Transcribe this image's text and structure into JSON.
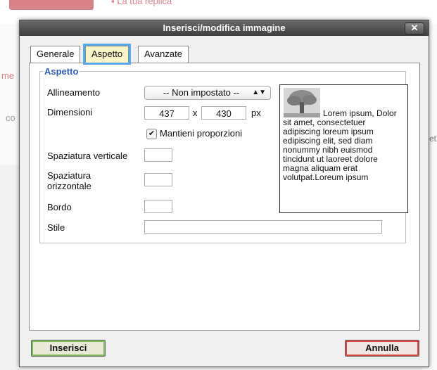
{
  "background": {
    "reply_text": "La tua replica",
    "left_fragment_1": "me",
    "left_fragment_2": "co",
    "right_fragment": "et"
  },
  "dialog": {
    "title": "Inserisci/modifica immagine",
    "close_label": "✕",
    "tabs": [
      {
        "label": "Generale",
        "active": false
      },
      {
        "label": "Aspetto",
        "active": true
      },
      {
        "label": "Avanzate",
        "active": false
      }
    ],
    "fieldset_legend": "Aspetto",
    "fields": {
      "alignment_label": "Allineamento",
      "alignment_value": "-- Non impostato --",
      "dimensions_label": "Dimensioni",
      "width_value": "437",
      "dimension_separator": "x",
      "height_value": "430",
      "unit": "px",
      "keep_proportions_label": "Mantieni proporzioni",
      "keep_proportions_checked": true,
      "vspace_label": "Spaziatura verticale",
      "vspace_value": "",
      "hspace_label_line1": "Spaziatura",
      "hspace_label_line2": "orizzontale",
      "hspace_value": "",
      "border_label": "Bordo",
      "border_value": "",
      "style_label": "Stile",
      "style_value": ""
    },
    "preview_text": "Lorem ipsum, Dolor sit amet, consectetuer adipiscing loreum ipsum edipiscing elit, sed diam nonummy nibh euismod tincidunt ut laoreet dolore magna aliquam erat volutpat.Loreum ipsum",
    "buttons": {
      "insert": "Inserisci",
      "cancel": "Annulla"
    }
  },
  "colors": {
    "accent_blue": "#5aa8e6",
    "legend_blue": "#2d5fae",
    "insert_green": "#7cba5a",
    "cancel_red": "#d8453b"
  }
}
